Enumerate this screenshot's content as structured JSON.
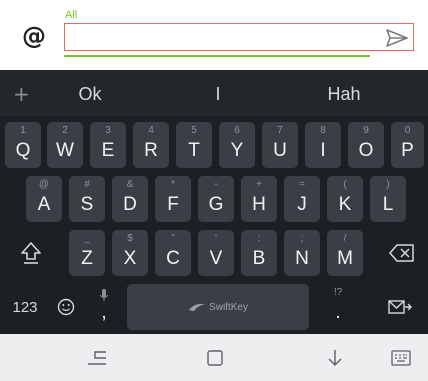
{
  "compose": {
    "at_symbol": "@",
    "filter_label": "All",
    "message_value": "",
    "message_placeholder": ""
  },
  "suggestions": {
    "add": "+",
    "items": [
      "Ok",
      "I",
      "Hah"
    ]
  },
  "keyboard": {
    "row1": [
      {
        "hint": "1",
        "key": "Q"
      },
      {
        "hint": "2",
        "key": "W"
      },
      {
        "hint": "3",
        "key": "E"
      },
      {
        "hint": "4",
        "key": "R"
      },
      {
        "hint": "5",
        "key": "T"
      },
      {
        "hint": "6",
        "key": "Y"
      },
      {
        "hint": "7",
        "key": "U"
      },
      {
        "hint": "8",
        "key": "I"
      },
      {
        "hint": "9",
        "key": "O"
      },
      {
        "hint": "0",
        "key": "P"
      }
    ],
    "row2": [
      {
        "hint": "@",
        "key": "A"
      },
      {
        "hint": "#",
        "key": "S"
      },
      {
        "hint": "&",
        "key": "D"
      },
      {
        "hint": "*",
        "key": "F"
      },
      {
        "hint": "-",
        "key": "G"
      },
      {
        "hint": "+",
        "key": "H"
      },
      {
        "hint": "=",
        "key": "J"
      },
      {
        "hint": "(",
        "key": "K"
      },
      {
        "hint": ")",
        "key": "L"
      }
    ],
    "row3": [
      {
        "hint": "_",
        "key": "Z"
      },
      {
        "hint": "$",
        "key": "X"
      },
      {
        "hint": "\"",
        "key": "C"
      },
      {
        "hint": "'",
        "key": "V"
      },
      {
        "hint": ":",
        "key": "B"
      },
      {
        "hint": ";",
        "key": "N"
      },
      {
        "hint": "/",
        "key": "M"
      }
    ],
    "numbers_label": "123",
    "comma": ",",
    "space_brand": "SwiftKey",
    "period_hint": "!?",
    "period": "."
  },
  "colors": {
    "accent_green": "#7cc52c",
    "input_border": "#e46a6a",
    "keyboard_bg": "#1c1f24",
    "key_bg": "#3b3f45"
  },
  "icons": {
    "send": "send-icon",
    "shift": "shift-icon",
    "backspace": "backspace-icon",
    "emoji": "emoji-icon",
    "mic": "mic-icon",
    "swiftkey": "swiftkey-logo-icon",
    "enter": "send-message-icon",
    "nav_back": "nav-back-icon",
    "nav_recent": "nav-recent-icon",
    "nav_hide": "nav-hide-keyboard-icon",
    "nav_switch": "nav-keyboard-switch-icon"
  }
}
